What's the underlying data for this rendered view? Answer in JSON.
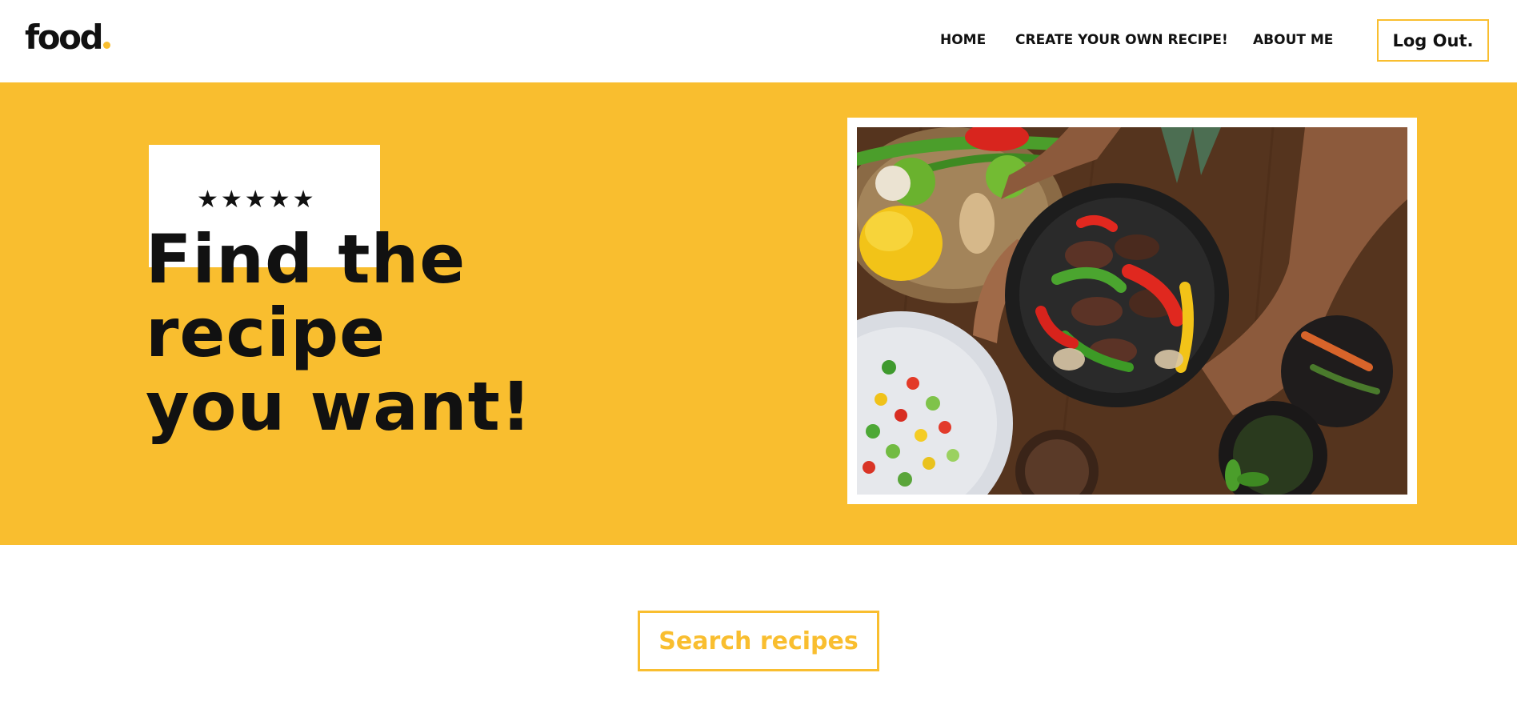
{
  "header": {
    "logo_text": "food",
    "nav": [
      {
        "label": "HOME"
      },
      {
        "label": "CREATE YOUR OWN RECIPE!"
      },
      {
        "label": "ABOUT ME"
      }
    ],
    "logout_label": "Log Out."
  },
  "hero": {
    "rating_stars": "★★★★★",
    "title_lines": [
      "Find the",
      "recipe",
      "you want!"
    ],
    "photo_icon": "food-photo"
  },
  "search": {
    "label": "Search recipes"
  },
  "colors": {
    "accent": "#f9be2f",
    "text": "#111111",
    "background": "#ffffff"
  }
}
